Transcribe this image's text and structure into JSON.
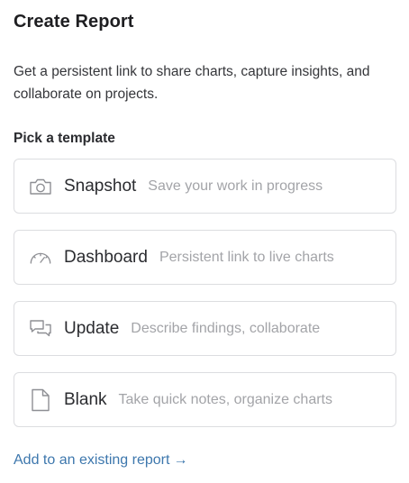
{
  "dialog": {
    "title": "Create Report",
    "description": "Get a persistent link to share charts, capture insights, and collaborate on projects.",
    "section_label": "Pick a template"
  },
  "templates": [
    {
      "icon": "camera-icon",
      "name": "Snapshot",
      "description": "Save your work in progress"
    },
    {
      "icon": "dashboard-gauge-icon",
      "name": "Dashboard",
      "description": "Persistent link to live charts"
    },
    {
      "icon": "chat-bubbles-icon",
      "name": "Update",
      "description": "Describe findings, collaborate"
    },
    {
      "icon": "document-icon",
      "name": "Blank",
      "description": "Take quick notes, organize charts"
    }
  ],
  "footer": {
    "existing_link_label": "Add to an existing report",
    "existing_link_arrow": "→"
  },
  "colors": {
    "link": "#3d77ad",
    "card_border": "#dcdde0",
    "muted_text": "#a3a4a8",
    "icon": "#8e8f94"
  }
}
